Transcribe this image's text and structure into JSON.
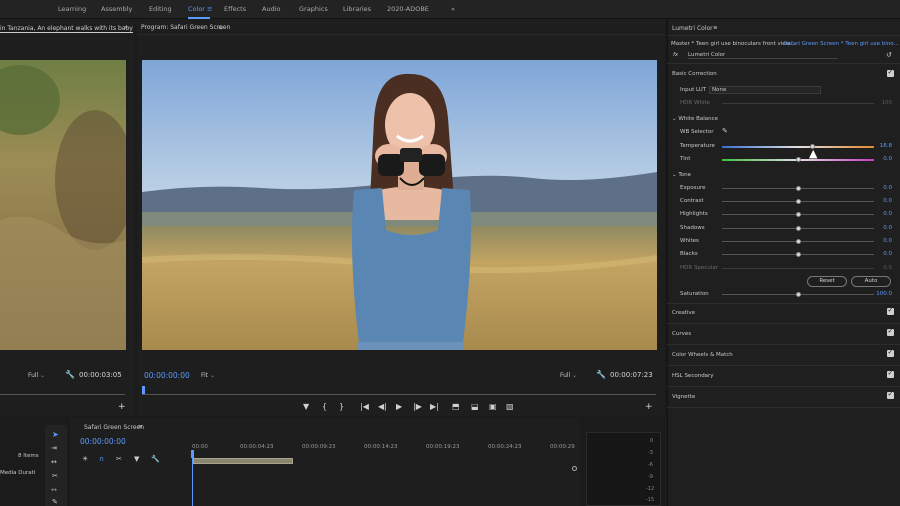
{
  "workspaces": [
    {
      "label": "Learning"
    },
    {
      "label": "Assembly"
    },
    {
      "label": "Editing"
    },
    {
      "label": "Color"
    },
    {
      "label": "Effects"
    },
    {
      "label": "Audio"
    },
    {
      "label": "Graphics"
    },
    {
      "label": "Libraries"
    },
    {
      "label": "2020-ADOBE"
    }
  ],
  "workspace_more": "»",
  "source": {
    "tab": "in Tanzania,  An elephant walks with its baby",
    "more": "»",
    "zoom": "Full",
    "timecode": "00:00:03:05"
  },
  "program": {
    "tab": "Program: Safari Green Screen",
    "tab_menu": "≡",
    "timecode": "00:00:00:00",
    "fit": "Fit",
    "full": "Full",
    "duration": "00:00:07:23"
  },
  "lumetri": {
    "tab": "Lumetri Color",
    "tab_menu": "≡",
    "master_clip": "Master * Teen girl use binoculars front view...",
    "sequence_clip": "Safari Green Screen * Teen girl use bino...",
    "fx": "fx",
    "effect": "Lumetri Color",
    "basic_correction": "Basic Correction",
    "input_lut_label": "Input LUT",
    "input_lut_value": "None",
    "hdr_white_label": "HDR White",
    "hdr_white_value": "100",
    "white_balance": "White Balance",
    "wb_selector": "WB Selector",
    "temperature_label": "Temperature",
    "temperature_value": "18.8",
    "tint_label": "Tint",
    "tint_value": "0.0",
    "tone": "Tone",
    "tone_rows": [
      {
        "label": "Exposure",
        "value": "0.0"
      },
      {
        "label": "Contrast",
        "value": "0.0"
      },
      {
        "label": "Highlights",
        "value": "0.0"
      },
      {
        "label": "Shadows",
        "value": "0.0"
      },
      {
        "label": "Whites",
        "value": "0.0"
      },
      {
        "label": "Blacks",
        "value": "0.0"
      }
    ],
    "hdr_specular_label": "HDR Specular",
    "hdr_specular_value": "0.0",
    "reset": "Reset",
    "auto": "Auto",
    "saturation_label": "Saturation",
    "saturation_value": "100.0",
    "sections": [
      "Creative",
      "Curves",
      "Color Wheels & Match",
      "HSL Secondary",
      "Vignette"
    ]
  },
  "timeline": {
    "tab": "Safari Green Screen",
    "tab_menu": "≡",
    "timecode": "00:00:00:00",
    "ruler": [
      "00:00",
      "00:00:04:23",
      "00:00:09:23",
      "00:00:14:23",
      "00:00:19:23",
      "00:00:24:23",
      "00:00:29"
    ]
  },
  "project": {
    "items": "8 Items",
    "column": "Media Durati"
  },
  "meter_scale": [
    "0",
    "-3",
    "-6",
    "-9",
    "-12",
    "-15"
  ],
  "colors": {
    "accent": "#5b9bff",
    "panel": "#1e1e1e",
    "sky": "#9fc0e6",
    "grass": "#b89a58"
  }
}
